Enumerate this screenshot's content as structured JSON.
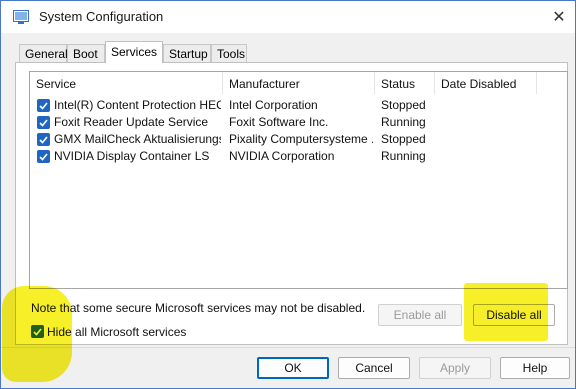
{
  "window": {
    "title": "System Configuration",
    "app_icon": "msconfig-icon",
    "close_icon": "close-icon"
  },
  "tabs": [
    {
      "label": "General",
      "active": false
    },
    {
      "label": "Boot",
      "active": false
    },
    {
      "label": "Services",
      "active": true
    },
    {
      "label": "Startup",
      "active": false
    },
    {
      "label": "Tools",
      "active": false
    }
  ],
  "services": {
    "columns": [
      "Service",
      "Manufacturer",
      "Status",
      "Date Disabled"
    ],
    "rows": [
      {
        "checked": true,
        "service": "Intel(R) Content Protection HEC...",
        "manufacturer": "Intel Corporation",
        "status": "Stopped",
        "date_disabled": ""
      },
      {
        "checked": true,
        "service": "Foxit Reader Update Service",
        "manufacturer": "Foxit Software Inc.",
        "status": "Running",
        "date_disabled": ""
      },
      {
        "checked": true,
        "service": "GMX MailCheck Aktualisierungsdi...",
        "manufacturer": "Pixality Computersysteme ...",
        "status": "Stopped",
        "date_disabled": ""
      },
      {
        "checked": true,
        "service": "NVIDIA Display Container LS",
        "manufacturer": "NVIDIA Corporation",
        "status": "Running",
        "date_disabled": ""
      }
    ]
  },
  "note": "Note that some secure Microsoft services may not be disabled.",
  "hide_ms": {
    "label": "Hide all Microsoft services",
    "checked": true
  },
  "buttons": {
    "enable_all": "Enable all",
    "disable_all": "Disable all",
    "ok": "OK",
    "cancel": "Cancel",
    "apply": "Apply",
    "help": "Help"
  },
  "colors": {
    "accent": "#1e66c2",
    "highlight": "#f7ef16",
    "window_border": "#4a78c9"
  }
}
